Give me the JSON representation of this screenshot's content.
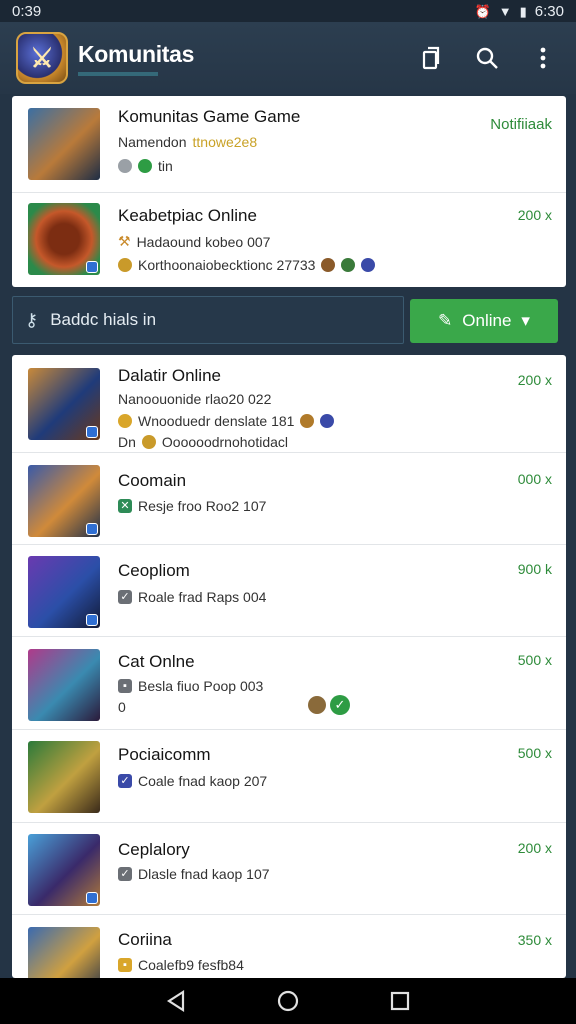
{
  "status_bar": {
    "time": "0:39",
    "right_time": "6:30"
  },
  "app_bar": {
    "title": "Komunitas"
  },
  "featured": [
    {
      "title": "Komunitas Game Game",
      "subtitle": "Namendon",
      "subtitle_tag": "ttnowe2e8",
      "meta": "tin",
      "right": "Notifiiaak",
      "thumb_colors": [
        "#3b6fa3",
        "#b97a3a",
        "#1e2d45"
      ]
    },
    {
      "title": "Keabetpiac Online",
      "subtitle": "Hadaound kobeo 007",
      "meta": "Korthoonaiobecktionc 27733",
      "right": "200 x",
      "thumb_colors": [
        "#c5582a",
        "#7c2d12",
        "#2b8a4a"
      ]
    }
  ],
  "filter": {
    "placeholder": "Baddc hials  in"
  },
  "online_button": {
    "label": "Online"
  },
  "list": [
    {
      "title": "Dalatir Online",
      "line1": "Nanoouonide rlao20 022",
      "line2": "Wnooduedr denslate 181",
      "line3": "Dn",
      "line3b": "Oooooodrnohotidacl",
      "right": "200 x",
      "thumb_colors": [
        "#c98a3a",
        "#1f3b7a",
        "#6b3a1a"
      ]
    },
    {
      "title": "Coomain",
      "line1": "Resje froo Roo2 107",
      "right": "000 x",
      "thumb_colors": [
        "#3a5aa8",
        "#d08a3a",
        "#20304a"
      ]
    },
    {
      "title": "Ceopliom",
      "line1": "Roale frad Raps 004",
      "right": "900 k",
      "thumb_colors": [
        "#6a3ab0",
        "#2b4fa8",
        "#121a36"
      ]
    },
    {
      "title": "Cat Onlne",
      "line1": "Besla fiuo Poop 003",
      "line2": "0",
      "right": "500 x",
      "thumb_colors": [
        "#b03a8a",
        "#3a8ab0",
        "#2b1a3a"
      ]
    },
    {
      "title": "Pociaicomm",
      "line1": "Coale fnad kaop 207",
      "right": "500 x",
      "thumb_colors": [
        "#2b7a3a",
        "#c0a040",
        "#3a2a1a"
      ]
    },
    {
      "title": "Ceplalory",
      "line1": "Dlasle fnad kaop 107",
      "right": "200 x",
      "thumb_colors": [
        "#4aa0d8",
        "#3a2a6a",
        "#b07a3a"
      ]
    },
    {
      "title": "Coriina",
      "line1": "Coalefb9 fesfb84",
      "right": "350 x",
      "thumb_colors": [
        "#3a6ab0",
        "#d0a040",
        "#1a2a4a"
      ]
    }
  ],
  "colors": {
    "accent_green": "#3aa84a",
    "header_bg": "#2c3e50",
    "count_green": "#2e8b3a"
  }
}
